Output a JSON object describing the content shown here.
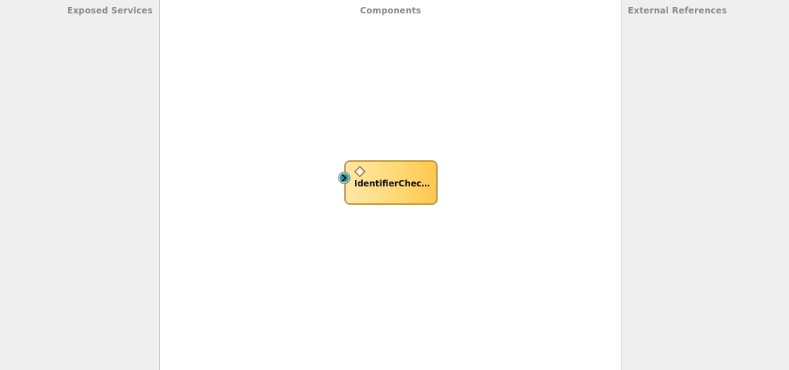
{
  "lanes": {
    "exposed_services": {
      "title": "Exposed Services"
    },
    "components": {
      "title": "Components"
    },
    "external_references": {
      "title": "External References"
    }
  },
  "component": {
    "label": "IdentifierCheck...",
    "icon": "diamond-icon",
    "service_icon": "service-port-icon",
    "fill_color": "#ffd978",
    "border_color": "#b8963e",
    "port_color": "#1aa1b3"
  }
}
